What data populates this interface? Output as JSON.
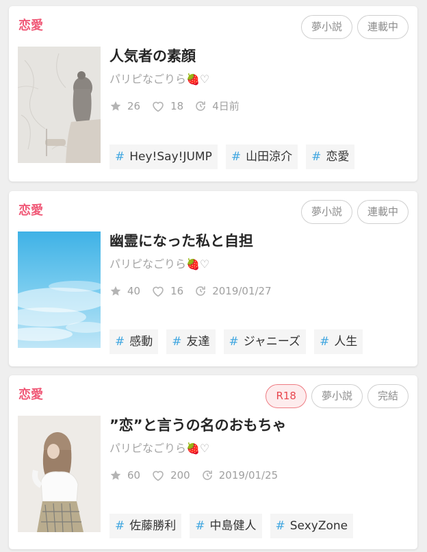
{
  "colors": {
    "genre": "#f05a78",
    "hash": "#3fa6e0",
    "r18": "#e8474f"
  },
  "icons": [
    "star-icon",
    "heart-icon",
    "update-icon"
  ],
  "cards": [
    {
      "genre": "恋愛",
      "badges": [
        "夢小説",
        "連載中"
      ],
      "title": "人気者の素顔",
      "author": "パリピなごりら🍓♡",
      "stars": "26",
      "likes": "18",
      "updated": "4日前",
      "tags": [
        "Hey!Say!JUMP",
        "山田涼介",
        "恋愛"
      ]
    },
    {
      "genre": "恋愛",
      "badges": [
        "夢小説",
        "連載中"
      ],
      "title": "幽霊になった私と自担",
      "author": "パリピなごりら🍓♡",
      "stars": "40",
      "likes": "16",
      "updated": "2019/01/27",
      "tags": [
        "感動",
        "友達",
        "ジャニーズ",
        "人生"
      ]
    },
    {
      "genre": "恋愛",
      "badge_r18": "R18",
      "badges": [
        "夢小説",
        "完結"
      ],
      "title": "”恋”と言うの名のおもちゃ",
      "author": "パリピなごりら🍓♡",
      "stars": "60",
      "likes": "200",
      "updated": "2019/01/25",
      "tags": [
        "佐藤勝利",
        "中島健人",
        "SexyZone"
      ]
    }
  ]
}
